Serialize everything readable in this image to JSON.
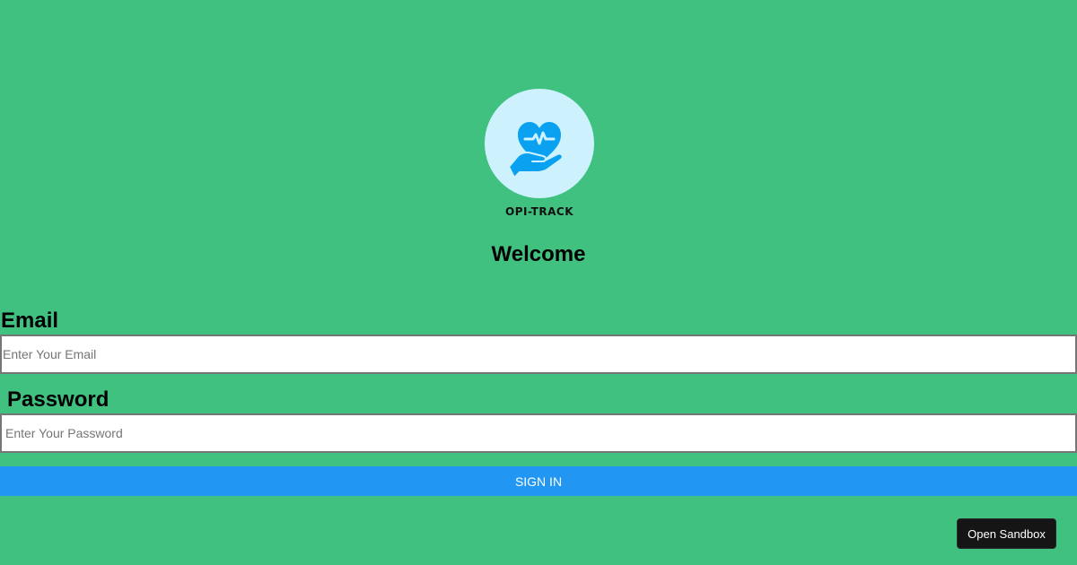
{
  "logo": {
    "text": "OPI-TRACK",
    "icon": "heart-hand-icon",
    "circle_color": "#cdf1fd",
    "icon_color": "#0aa1f0"
  },
  "welcome": "Welcome",
  "form": {
    "email_label": "Email",
    "email_placeholder": "Enter Your Email",
    "password_label": "Password",
    "password_placeholder": "Enter Your Password",
    "signin_label": "SIGN IN"
  },
  "sandbox_label": "Open Sandbox",
  "colors": {
    "background": "#41c180",
    "button": "#2196f3",
    "sandbox_button": "#151515"
  }
}
